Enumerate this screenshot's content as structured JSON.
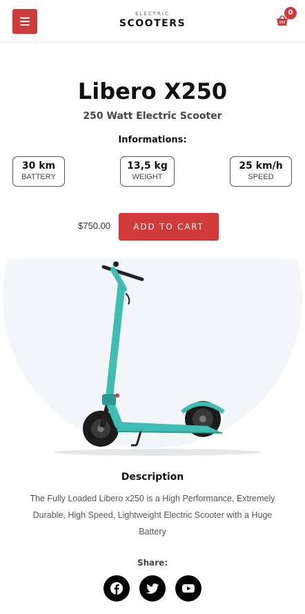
{
  "header": {
    "menu_icon": "hamburger-menu-icon",
    "brand_top": "ELECTRIC",
    "brand_main": "SCOOTERS",
    "cart_icon": "shopping-basket-icon",
    "cart_count": "0"
  },
  "product": {
    "name": "Libero X250",
    "subtitle": "250 Watt Electric Scooter",
    "info_heading": "Informations:",
    "specs": [
      {
        "value": "30 km",
        "label": "BATTERY"
      },
      {
        "value": "13,5 kg",
        "label": "WEIGHT"
      },
      {
        "value": "25 km/h",
        "label": "SPEED"
      }
    ],
    "price": "$750.00",
    "add_to_cart_label": "ADD TO CART",
    "image_alt": "teal-electric-scooter-image"
  },
  "description": {
    "heading": "Description",
    "text": "The Fully Loaded Libero x250 is a High Performance, Extremely Durable, High Speed, Lightweight Electric Scooter with a Huge Battery"
  },
  "share": {
    "heading": "Share:",
    "icons": [
      "facebook-icon",
      "twitter-icon",
      "youtube-icon"
    ]
  },
  "colors": {
    "accent": "#cf3a3a",
    "scooter_body": "#3ebdb3",
    "hero_background": "#f2f6f8",
    "social_background": "#000000"
  }
}
